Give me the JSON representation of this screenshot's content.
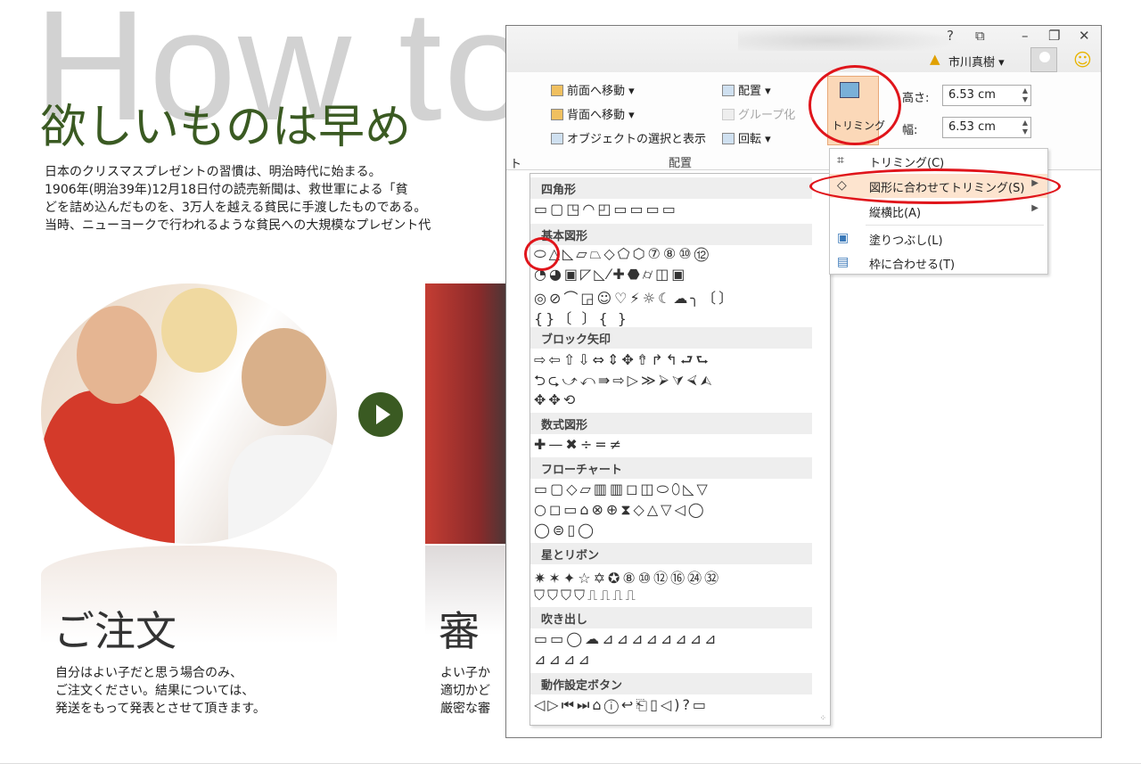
{
  "slide": {
    "bg_title": "How to",
    "headline": "欲しいものは早め",
    "body_lines": [
      "日本のクリスマスプレゼントの習慣は、明治時代に始まる。",
      "1906年(明治39年)12月18日付の読売新聞は、救世軍による「貧",
      "どを詰め込んだものを、3万人を越える貧民に手渡したものである。",
      "当時、ニューヨークで行われるような貧民への大規模なプレゼント代"
    ],
    "section1": {
      "title": "ご注文",
      "lines": [
        "自分はよい子だと思う場合のみ、",
        "ご注文ください。結果については、",
        "発送をもって発表とさせて頂きます。"
      ]
    },
    "section2": {
      "title": "審",
      "lines": [
        "よい子か",
        "適切かど",
        "厳密な審"
      ]
    }
  },
  "window": {
    "help": "?",
    "restore_ribbon": "⧉",
    "minimize": "–",
    "maximize": "❐",
    "close": "✕",
    "user_name": "市川真樹 ▾",
    "ribbon": {
      "bring_forward": "前面へ移動",
      "send_backward": "背面へ移動",
      "selection_pane": "オブジェクトの選択と表示",
      "align": "配置",
      "group": "グループ化",
      "rotate": "回転",
      "group_label": "配置",
      "crop": "トリミング",
      "height_label": "高さ:",
      "height_value": "6.53 cm",
      "width_label": "幅:",
      "width_value": "6.53 cm",
      "cut_text": "ト"
    }
  },
  "gallery": {
    "categories": [
      "四角形",
      "基本図形",
      "ブロック矢印",
      "数式図形",
      "フローチャート",
      "星とリボン",
      "吹き出し",
      "動作設定ボタン"
    ],
    "rows": [
      "▭▢◳◠◰▭▭▭▭",
      "⬭△◺▱⏢◇⬠⬡⑦⑧⑩⑫",
      "◔◕▣◸◺⁄✚⬣⌭◫▣",
      "◎⊘⌒◲☺♡⚡☼☾☁╮〔〕",
      "{}〔 〕{ }",
      "⇨⇦⇧⇩⇔⇕✥⇮↱↰⮐⮑",
      "⮌⮎⤻⤺⇛⇨▷≫⮚⮛⮘⮙",
      "✥✥⟲",
      "✚—✖÷=≠",
      "▭▢◇▱▥▥◻◫⬭⬯◺▽",
      "○◻▭⌂⊗⊕⧗◇△▽◁◯",
      "◯⊜▯◯",
      "✷✶✦☆✡✪⑧⑩⑫⑯㉔㉜",
      "⛉⛉⛉⛉⎍⎍⎍⎍",
      "▭▭◯☁⊿⊿⊿⊿⊿⊿⊿⊿",
      "⊿⊿⊿⊿",
      "◁▷⏮⏭⌂ⓘ↩⎗▯◁)?▭"
    ]
  },
  "trim_menu": {
    "items": [
      "トリミング(C)",
      "図形に合わせてトリミング(S)",
      "縦横比(A)",
      "塗りつぶし(L)",
      "枠に合わせる(T)"
    ]
  },
  "accent_colors": {
    "annotation": "#e0151b",
    "highlight": "#fde4cf",
    "heading_green": "#3a5a22"
  }
}
